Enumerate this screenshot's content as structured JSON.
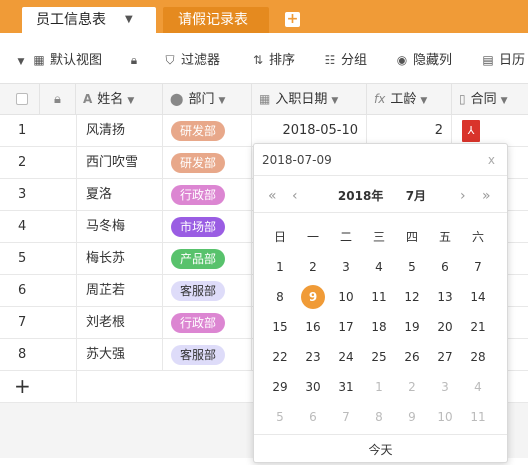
{
  "tabs": [
    {
      "label": "员工信息表",
      "active": true
    },
    {
      "label": "请假记录表",
      "active": false
    }
  ],
  "toolbar": {
    "default_view": "默认视图",
    "filter": "过滤器",
    "sort": "排序",
    "group": "分组",
    "hide_cols": "隐藏列",
    "calendar": "日历"
  },
  "columns": [
    "姓名",
    "部门",
    "入职日期",
    "工龄",
    "合同"
  ],
  "rows": [
    {
      "no": "1",
      "name": "风清扬",
      "dept": "研发部",
      "date": "2018-05-10",
      "years": "2",
      "has_contract": true
    },
    {
      "no": "2",
      "name": "西门吹雪",
      "dept": "研发部",
      "date": "",
      "years": "",
      "has_contract": false
    },
    {
      "no": "3",
      "name": "夏洛",
      "dept": "行政部",
      "date": "",
      "years": "",
      "has_contract": false
    },
    {
      "no": "4",
      "name": "马冬梅",
      "dept": "市场部",
      "date": "",
      "years": "",
      "has_contract": false
    },
    {
      "no": "5",
      "name": "梅长苏",
      "dept": "产品部",
      "date": "",
      "years": "",
      "has_contract": false
    },
    {
      "no": "6",
      "name": "周芷若",
      "dept": "客服部",
      "date": "",
      "years": "",
      "has_contract": false
    },
    {
      "no": "7",
      "name": "刘老根",
      "dept": "行政部",
      "date": "",
      "years": "",
      "has_contract": false
    },
    {
      "no": "8",
      "name": "苏大强",
      "dept": "客服部",
      "date": "",
      "years": "",
      "has_contract": false
    }
  ],
  "dept_colors": {
    "研发部": {
      "bg": "#e8a88a",
      "fg": "#ffffff"
    },
    "行政部": {
      "bg": "#dc86d2",
      "fg": "#ffffff"
    },
    "市场部": {
      "bg": "#9a5de3",
      "fg": "#ffffff"
    },
    "产品部": {
      "bg": "#58c26c",
      "fg": "#ffffff"
    },
    "客服部": {
      "bg": "#dedcf9",
      "fg": "#333333"
    }
  },
  "add_row": "+",
  "calendar": {
    "input_value": "2018-07-09",
    "close": "x",
    "year": "2018年",
    "month": "7月",
    "weekdays": [
      "日",
      "一",
      "二",
      "三",
      "四",
      "五",
      "六"
    ],
    "weeks": [
      [
        [
          "1",
          false
        ],
        [
          "2",
          false
        ],
        [
          "3",
          false
        ],
        [
          "4",
          false
        ],
        [
          "5",
          false
        ],
        [
          "6",
          false
        ],
        [
          "7",
          false
        ]
      ],
      [
        [
          "8",
          false
        ],
        [
          "9",
          false
        ],
        [
          "10",
          false
        ],
        [
          "11",
          false
        ],
        [
          "12",
          false
        ],
        [
          "13",
          false
        ],
        [
          "14",
          false
        ]
      ],
      [
        [
          "15",
          false
        ],
        [
          "16",
          false
        ],
        [
          "17",
          false
        ],
        [
          "18",
          false
        ],
        [
          "19",
          false
        ],
        [
          "20",
          false
        ],
        [
          "21",
          false
        ]
      ],
      [
        [
          "22",
          false
        ],
        [
          "23",
          false
        ],
        [
          "24",
          false
        ],
        [
          "25",
          false
        ],
        [
          "26",
          false
        ],
        [
          "27",
          false
        ],
        [
          "28",
          false
        ]
      ],
      [
        [
          "29",
          false
        ],
        [
          "30",
          false
        ],
        [
          "31",
          false
        ],
        [
          "1",
          true
        ],
        [
          "2",
          true
        ],
        [
          "3",
          true
        ],
        [
          "4",
          true
        ]
      ],
      [
        [
          "5",
          true
        ],
        [
          "6",
          true
        ],
        [
          "7",
          true
        ],
        [
          "8",
          true
        ],
        [
          "9",
          true
        ],
        [
          "10",
          true
        ],
        [
          "11",
          true
        ]
      ]
    ],
    "selected_day": "9",
    "today": "今天"
  },
  "accent": "#f09b37"
}
